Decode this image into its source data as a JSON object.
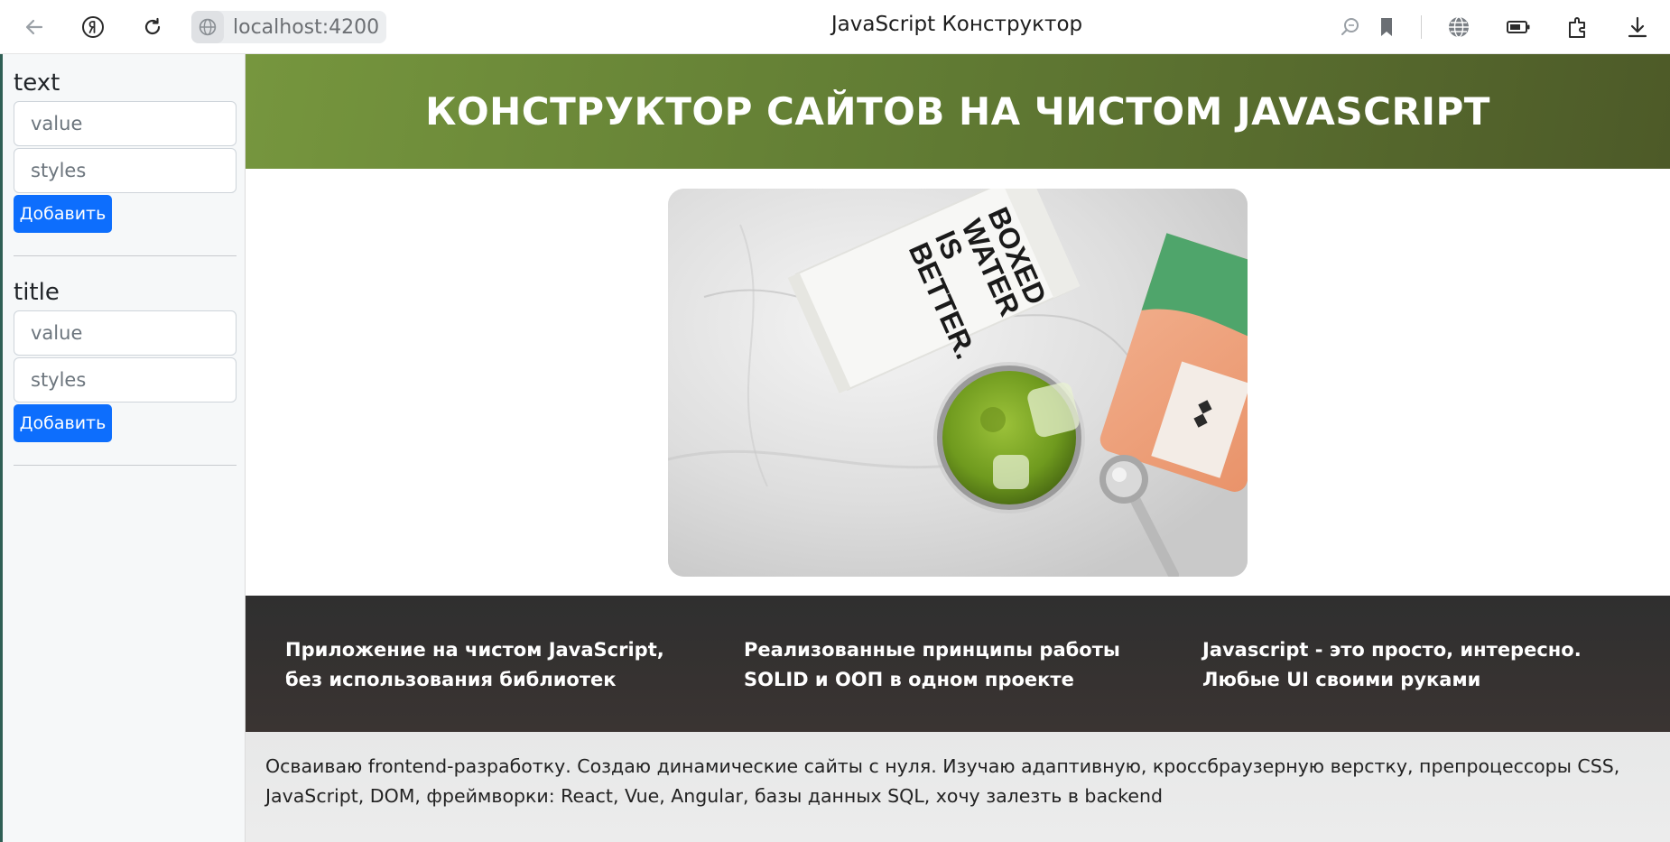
{
  "browser": {
    "url": "localhost:4200",
    "tab_title": "JavaScript Конструктор",
    "icons": [
      "back-arrow-icon",
      "yandex-logo-icon",
      "reload-icon",
      "globe-icon",
      "search-icon",
      "bookmark-icon",
      "translate-icon",
      "battery-icon",
      "extensions-icon",
      "download-icon"
    ]
  },
  "sidebar": {
    "blocks": [
      {
        "heading": "text",
        "value_placeholder": "value",
        "styles_placeholder": "styles",
        "button_label": "Добавить"
      },
      {
        "heading": "title",
        "value_placeholder": "value",
        "styles_placeholder": "styles",
        "button_label": "Добавить"
      }
    ]
  },
  "site": {
    "title": "КОНСТРУКТОР САЙТОВ НА ЧИСТОМ JAVASCRIPT",
    "image": {
      "carton_text": [
        "BOXED",
        "WATER",
        "IS",
        "BETTER."
      ]
    },
    "features": [
      "Приложение на чистом JavaScript, без использования библиотек",
      "Реализованные принципы работы SOLID и ООП в одном проекте",
      "Javascript - это просто, интересно. Любые UI своими руками"
    ],
    "about": "Осваиваю frontend-разработку. Создаю динамические сайты с нуля. Изучаю адаптивную, кроссбраузерную верстку, препроцессоры CSS, JavaScript, DOM, фреймворки: React, Vue, Angular, базы данных SQL, хочу залезть в backend"
  },
  "colors": {
    "header_gradient": [
      "#76963e",
      "#4d5a28"
    ],
    "primary_button": "#0d6efd",
    "features_bg": "#363230",
    "about_bg": "#e9e9e9"
  }
}
